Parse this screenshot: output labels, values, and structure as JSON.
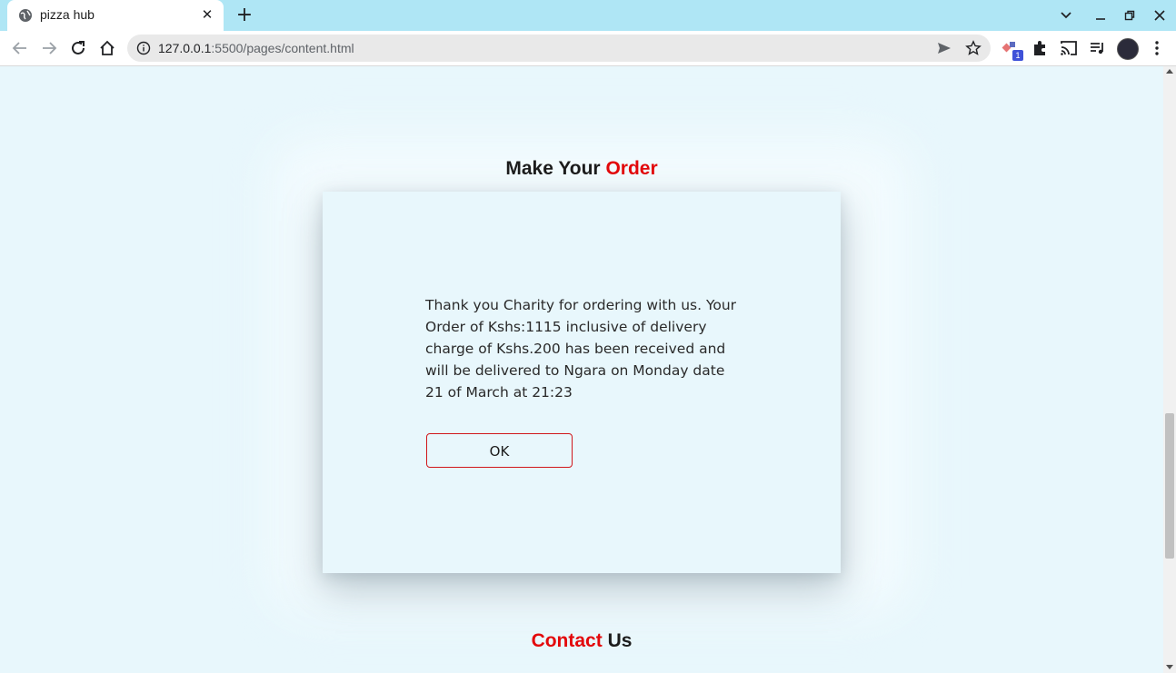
{
  "browser": {
    "tab_title": "pizza hub",
    "tab_close": "✕",
    "new_tab": "+",
    "url_host": "127.0.0.1",
    "url_path": ":5500/pages/content.html",
    "extension_badge": "1",
    "window_controls": {
      "dropdown": "⌄",
      "minimize": "–",
      "restore": "❐",
      "close": "✕"
    }
  },
  "order_section": {
    "title_part1": "Make Your",
    "title_part2": "Order",
    "message": "Thank you Charity for ordering with us. Your Order of Kshs:1115 inclusive of delivery charge of Kshs.200 has been received and will be delivered to Ngara on Monday date 21 of March at 21:23",
    "ok_label": "OK"
  },
  "contact_section": {
    "title_part1": "Contact",
    "title_part2": "Us"
  },
  "colors": {
    "accent": "#e3080b",
    "page_bg": "#e8f7fc",
    "tabstrip_bg": "#afe6f5"
  }
}
